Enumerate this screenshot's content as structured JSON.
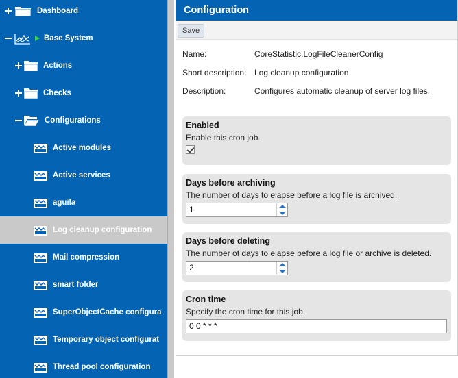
{
  "sidebar": {
    "items": [
      {
        "label": "Dashboard"
      },
      {
        "label": "Base System"
      },
      {
        "label": "Actions"
      },
      {
        "label": "Checks"
      },
      {
        "label": "Configurations"
      },
      {
        "label": "Active modules"
      },
      {
        "label": "Active services"
      },
      {
        "label": "aguila"
      },
      {
        "label": "Log cleanup configuration"
      },
      {
        "label": "Mail compression"
      },
      {
        "label": "smart folder"
      },
      {
        "label": "SuperObjectCache configura"
      },
      {
        "label": "Temporary object configurat"
      },
      {
        "label": "Thread pool configuration"
      }
    ],
    "selected": "Log cleanup configuration"
  },
  "header": {
    "title": "Configuration"
  },
  "toolbar": {
    "save_label": "Save"
  },
  "info": {
    "name_label": "Name:",
    "name_value": "CoreStatistic.LogFileCleanerConfig",
    "short_label": "Short description:",
    "short_value": "Log cleanup configuration",
    "desc_label": "Description:",
    "desc_value": "Configures automatic cleanup of server log files."
  },
  "sections": {
    "enabled": {
      "title": "Enabled",
      "description": "Enable this cron job.",
      "checked": true
    },
    "archiving": {
      "title": "Days before archiving",
      "description": "The number of days to elapse before a log file is archived.",
      "value": "1"
    },
    "deleting": {
      "title": "Days before deleting",
      "description": "The number of days to elapse before a log file or archive is deleted.",
      "value": "2"
    },
    "cron": {
      "title": "Cron time",
      "description": "Specify the cron time for this job.",
      "value": "0 0 * * *"
    }
  },
  "colors": {
    "brand_blue": "#0563b4",
    "selected_gray": "#c9c9c9",
    "play_green": "#37d63a"
  }
}
